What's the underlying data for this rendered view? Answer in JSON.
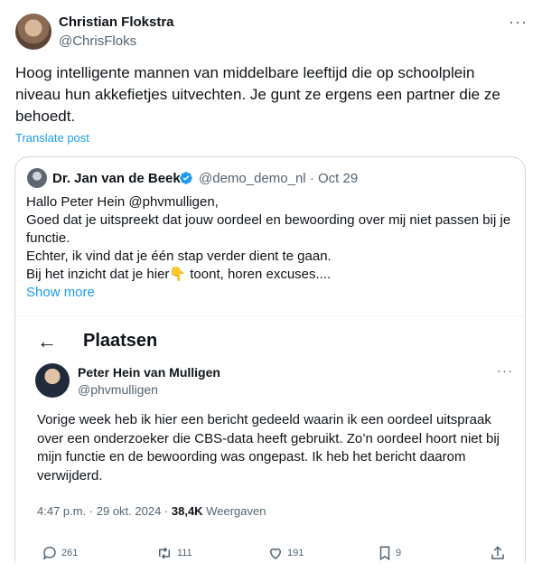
{
  "tweet": {
    "author_name": "Christian Flokstra",
    "author_handle": "@ChrisFloks",
    "more_label": "···",
    "text": "Hoog intelligente mannen van middelbare leeftijd die op schoolplein niveau hun akkefietjes uitvechten. Je gunt ze ergens een partner die ze behoedt.",
    "translate_label": "Translate post"
  },
  "quote": {
    "author_name": "Dr. Jan van de Beek",
    "verified": true,
    "author_handle": "@demo_demo_nl",
    "separator": "·",
    "date": "Oct 29",
    "text_lines": [
      "Hallo Peter Hein @phvmulligen,",
      "Goed dat je uitspreekt dat jouw oordeel en bewoording over mij niet passen bij je functie.",
      "Echter, ik vind dat je één stap verder dient te gaan.",
      "Bij het inzicht dat je hier👇 toont, horen excuses...."
    ],
    "show_more_label": "Show more"
  },
  "screenshot": {
    "back_icon": "←",
    "page_title": "Plaatsen",
    "author_name": "Peter Hein van Mulligen",
    "author_handle": "@phvmulligen",
    "more_label": "···",
    "text": "Vorige week heb ik hier een bericht gedeeld waarin ik een oordeel uitspraak over een onderzoeker die CBS-data heeft gebruikt. Zo’n oordeel hoort niet bij mijn functie en de bewoording was ongepast. Ik heb het bericht daarom verwijderd.",
    "time": "4:47 p.m. · 29 okt. 2024 ·",
    "views_count": "38,4K",
    "views_label": "Weergaven",
    "stats": {
      "replies": "261",
      "reposts": "111",
      "likes": "191",
      "bookmarks": "9"
    }
  },
  "colors": {
    "link": "#1d9bf0",
    "secondary_text": "#536471",
    "border": "#cfd9de"
  }
}
